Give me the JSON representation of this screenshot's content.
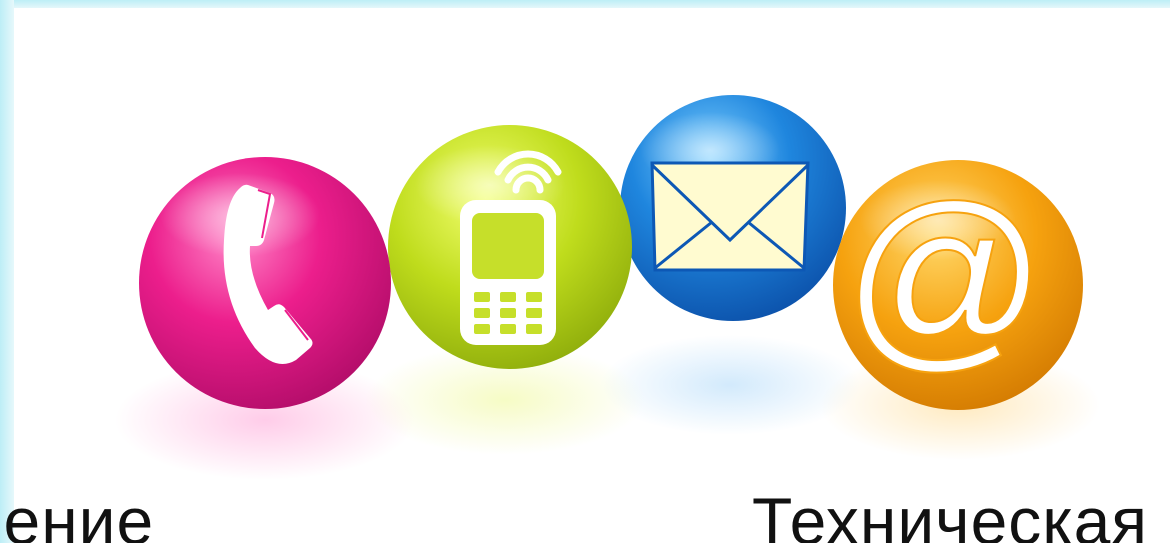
{
  "captions": {
    "left": "ление",
    "right": "Техническая"
  },
  "icons": [
    {
      "name": "phone-handset-icon",
      "color": "#ec1e8c"
    },
    {
      "name": "mobile-phone-icon",
      "color": "#b8d819"
    },
    {
      "name": "envelope-icon",
      "color": "#1c7fd8"
    },
    {
      "name": "at-sign-icon",
      "color": "#f4a10c"
    }
  ],
  "colors": {
    "frame": "#bdeef6",
    "background": "#ffffff",
    "text": "#111111"
  }
}
